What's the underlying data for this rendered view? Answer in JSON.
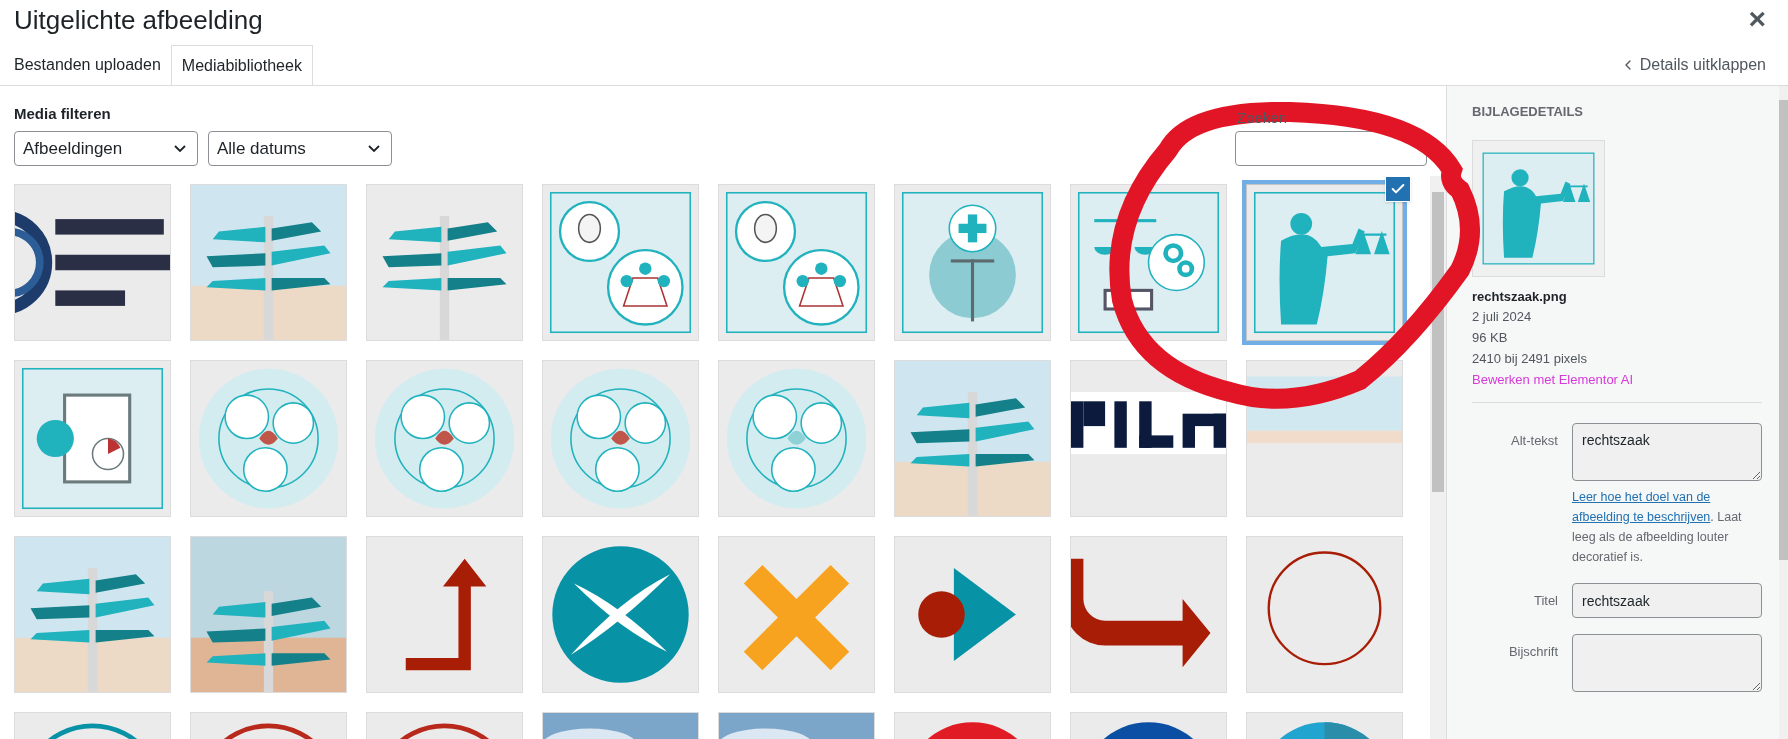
{
  "window": {
    "title": "Uitgelichte afbeelding",
    "close": "×"
  },
  "tabs": [
    {
      "label": "Bestanden uploaden",
      "selected": false
    },
    {
      "label": "Mediabibliotheek",
      "selected": true
    }
  ],
  "toggle_details": "Details uitklappen",
  "filters": {
    "label": "Media filteren",
    "type": "Afbeeldingen",
    "date": "Alle datums"
  },
  "search": {
    "label": "Zoeken"
  },
  "tiles": [
    {
      "selected": false
    },
    {
      "selected": false
    },
    {
      "selected": false
    },
    {
      "selected": false
    },
    {
      "selected": false
    },
    {
      "selected": false
    },
    {
      "selected": false
    },
    {
      "selected": true
    },
    {
      "selected": false
    },
    {
      "selected": false
    },
    {
      "selected": false
    },
    {
      "selected": false
    },
    {
      "selected": false
    },
    {
      "selected": false
    },
    {
      "selected": false
    },
    {
      "selected": false
    },
    {
      "selected": false
    },
    {
      "selected": false
    },
    {
      "selected": false
    },
    {
      "selected": false
    },
    {
      "selected": false
    },
    {
      "selected": false
    },
    {
      "selected": false
    },
    {
      "selected": false
    },
    {
      "selected": false
    },
    {
      "selected": false
    },
    {
      "selected": false
    },
    {
      "selected": false
    },
    {
      "selected": false
    },
    {
      "selected": false
    },
    {
      "selected": false
    },
    {
      "selected": false
    }
  ],
  "details": {
    "heading": "BIJLAGEDETAILS",
    "filename": "rechtszaak.png",
    "date": "2 juli 2024",
    "size": "96 KB",
    "dimensions": "2410 bij 2491 pixels",
    "edit_link": "Bewerken met Elementor AI",
    "fields": [
      {
        "kind": "textarea",
        "label": "Alt-tekst",
        "value": "rechtszaak",
        "help_link": [
          "Leer hoe het doel van de",
          "afbeelding te beschrijven"
        ],
        "help_text": ". Laat leeg als de afbeelding louter decoratief is."
      },
      {
        "kind": "input",
        "label": "Titel",
        "value": "rechtszaak"
      },
      {
        "kind": "textarea",
        "label": "Bijschrift"
      }
    ]
  }
}
